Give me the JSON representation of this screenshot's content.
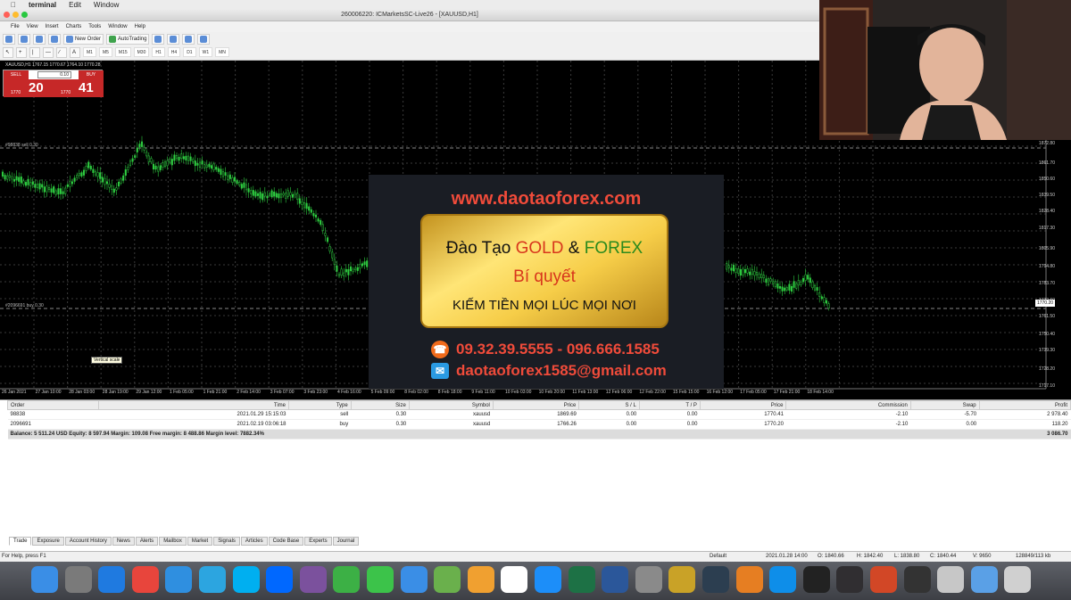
{
  "mac_menu": {
    "app": "terminal",
    "items": [
      "Edit",
      "Window"
    ]
  },
  "window_title": "26000​6220: ICMarketsSC-Live26 - [XAUUSD,H1]",
  "menu": [
    "File",
    "View",
    "Insert",
    "Charts",
    "Tools",
    "Window",
    "Help"
  ],
  "toolbar": {
    "new_order": "New Order",
    "autotrading": "AutoTrading",
    "timeframes": [
      "M1",
      "M5",
      "M15",
      "M30",
      "H1",
      "H4",
      "D1",
      "W1",
      "MN"
    ]
  },
  "chart": {
    "symbol_info": "XAUUSD,H1  1767.15 1770.67 1764.10 1770.28",
    "trade_panel": {
      "sell_label": "SELL",
      "buy_label": "BUY",
      "lot": "0.10",
      "bid_small": "1770",
      "bid_big": "20",
      "ask_small": "1770",
      "ask_big": "41"
    },
    "order_lines": [
      "#98838 sell 0.30",
      "#2096691 buy 0.30"
    ],
    "tooltip": "Vertical scale",
    "price_ticks": [
      "1872.80",
      "1861.70",
      "1850.60",
      "1839.50",
      "1828.40",
      "1817.30",
      "1805.90",
      "1794.80",
      "1783.70",
      "1772.60",
      "1770.20",
      "1761.50",
      "1750.40",
      "1739.30",
      "1728.20",
      "1717.10"
    ],
    "current_price": "1770.20",
    "time_ticks": [
      "26 Jan 2021",
      "27 Jan 10:00",
      "28 Jan 03:00",
      "28 Jan 19:00",
      "29 Jan 12:00",
      "1 Feb 05:00",
      "1 Feb 21:00",
      "2 Feb 14:00",
      "3 Feb 07:00",
      "3 Feb 23:00",
      "4 Feb 16:00",
      "5 Feb 09:00",
      "8 Feb 02:00",
      "8 Feb 18:00",
      "9 Feb 11:00",
      "10 Feb 03:00",
      "10 Feb 20:00",
      "11 Feb 13:00",
      "12 Feb 06:00",
      "12 Feb 22:00",
      "15 Feb 15:00",
      "16 Feb 12:00",
      "17 Feb 05:00",
      "17 Feb 21:00",
      "18 Feb 14:00"
    ]
  },
  "promo": {
    "url": "www.daotaoforex.com",
    "line1_a": "Đào Tạo ",
    "line1_gold": "GOLD",
    "line1_amp": " & ",
    "line1_forex": "FOREX",
    "line2": "Bí quyết",
    "line3": "KIẾM TIỀN MỌI LÚC MỌI NƠI",
    "phone": "09.32.39.5555 - 096.666.1585",
    "email": "daotaoforex1585@gmail.com"
  },
  "terminal": {
    "columns": [
      "Order",
      "Time",
      "Type",
      "Size",
      "Symbol",
      "Price",
      "S / L",
      "T / P",
      "Price",
      "Commission",
      "Swap",
      "Profit"
    ],
    "rows": [
      [
        "98838",
        "2021.01.29 15:15:03",
        "sell",
        "0.30",
        "xauusd",
        "1869.69",
        "0.00",
        "0.00",
        "1770.41",
        "-2.10",
        "-5.70",
        "2 978.40"
      ],
      [
        "2096691",
        "2021.02.19 03:06:18",
        "buy",
        "0.30",
        "xauusd",
        "1766.26",
        "0.00",
        "0.00",
        "1770.20",
        "-2.10",
        "0.00",
        "118.20"
      ]
    ],
    "balance_line": "Balance: 5 511.24 USD  Equity: 8 597.94  Margin: 109.08  Free margin: 8 488.86  Margin level: 7882.34%",
    "balance_profit": "3 086.70",
    "tabs": [
      "Trade",
      "Exposure",
      "Account History",
      "News",
      "Alerts",
      "Mailbox",
      "Market",
      "Signals",
      "Articles",
      "Code Base",
      "Experts",
      "Journal"
    ]
  },
  "status": {
    "help": "For Help, press F1",
    "profile": "Default",
    "datetime": "2021.01.28 14:00",
    "open": "O: 1840.66",
    "high": "H: 1842.40",
    "low": "L: 1838.80",
    "close": "C: 1840.44",
    "volume": "V: 9650",
    "traffic": "128849/113 kb"
  },
  "dock": [
    "Finder",
    "Launchpad",
    "Safari",
    "Chrome",
    "Sync",
    "Telegram",
    "Skype",
    "Zalo",
    "Viber",
    "Line",
    "Messages",
    "Chat",
    "Maps",
    "Photos",
    "Calendar",
    "App Store",
    "Excel",
    "Word",
    "System Preferences",
    "Archive",
    "QuickTime",
    "Photos2",
    "TeamViewer",
    "Terminal",
    "OBS",
    "PowerPoint",
    "Terminal2",
    "Preview",
    "Finder2",
    "Trash"
  ]
}
